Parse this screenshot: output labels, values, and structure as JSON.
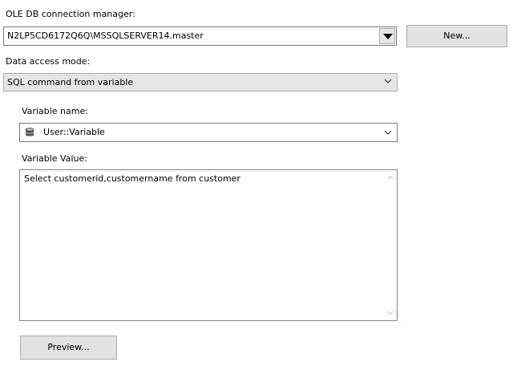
{
  "connection": {
    "label": "OLE DB connection manager:",
    "value": "N2LP5CD6172Q6Q\\MSSQLSERVER14.master",
    "new_button": "New..."
  },
  "access_mode": {
    "label": "Data access mode:",
    "value": "SQL command from variable"
  },
  "variable": {
    "name_label": "Variable name:",
    "name_value": "User::Variable",
    "icon": "variable-cylinder-icon",
    "value_label": "Variable Value:",
    "value_text": "Select customerid,customername from customer"
  },
  "preview_button": "Preview..."
}
